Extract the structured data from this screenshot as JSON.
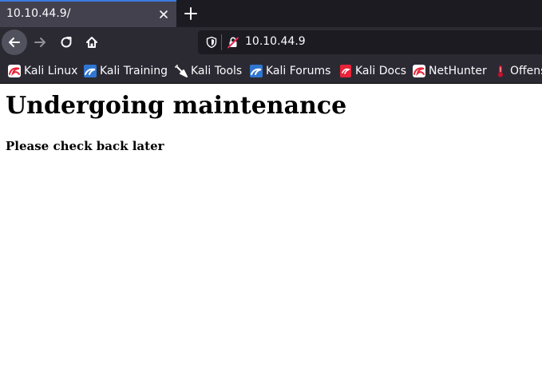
{
  "tab": {
    "title": "10.10.44.9/"
  },
  "toolbar": {
    "url": "10.10.44.9"
  },
  "bookmarks": [
    {
      "label": "Kali Linux",
      "icon": "kali-linux-icon"
    },
    {
      "label": "Kali Training",
      "icon": "kali-training-icon"
    },
    {
      "label": "Kali Tools",
      "icon": "kali-tools-icon"
    },
    {
      "label": "Kali Forums",
      "icon": "kali-forums-icon"
    },
    {
      "label": "Kali Docs",
      "icon": "kali-docs-icon"
    },
    {
      "label": "NetHunter",
      "icon": "nethunter-icon"
    },
    {
      "label": "Offens",
      "icon": "offensive-security-icon"
    }
  ],
  "page": {
    "heading": "Undergoing maintenance",
    "subheading": "Please check back later"
  },
  "colors": {
    "tab_accent": "#3d7be0",
    "chrome_bg": "#2b2a33",
    "tabstrip_bg": "#1c1b22",
    "kali_red": "#e8233a",
    "kali_blue": "#2f76d2"
  }
}
